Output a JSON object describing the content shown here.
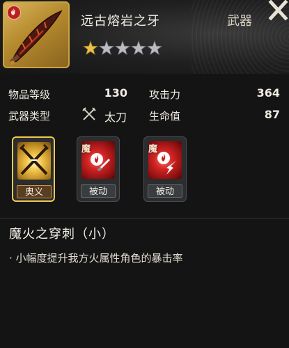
{
  "item": {
    "name": "远古熔岩之牙",
    "type": "武器",
    "stars_filled": 1,
    "stars_total": 5,
    "element_icon": "fire-element-icon"
  },
  "close_label": "X",
  "stats": {
    "item_level_label": "物品等级",
    "item_level_value": "130",
    "attack_label": "攻击力",
    "attack_value": "364",
    "weapon_type_label": "武器类型",
    "weapon_type_value": "太刀",
    "hp_label": "生命值",
    "hp_value": "87"
  },
  "skills": [
    {
      "tag": "奥义",
      "style": "gold",
      "icon": "crossed-swords-icon"
    },
    {
      "tag": "被动",
      "style": "dark",
      "corner": "魔",
      "icon": "fire-sword-icon"
    },
    {
      "tag": "被动",
      "style": "dark",
      "corner": "魔",
      "icon": "fire-lightning-icon"
    }
  ],
  "detail": {
    "title": "魔火之穿刺（小）",
    "description": "· 小幅度提升我方火属性角色的暴击率"
  },
  "colors": {
    "gold": "#c9a445",
    "fire_red": "#b81e1e",
    "background": "#141414"
  }
}
